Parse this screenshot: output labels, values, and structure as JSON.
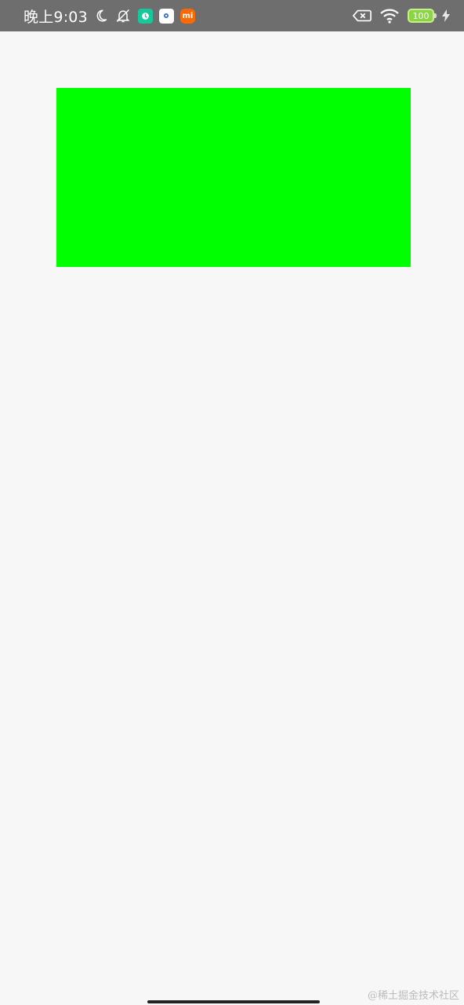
{
  "status_bar": {
    "time": "晚上9:03",
    "icons": {
      "moon": "moon-icon",
      "mute": "bell-off-icon",
      "app1": "green-app-icon",
      "app2": "white-app-icon",
      "app3": "mi-app-icon",
      "sim": "no-sim-icon",
      "wifi": "wifi-icon",
      "charging": "charging-bolt-icon"
    },
    "app3_label": "mi",
    "battery_level": "100"
  },
  "content": {
    "rect_color": "#00ff00"
  },
  "watermark": "@稀土掘金技术社区"
}
